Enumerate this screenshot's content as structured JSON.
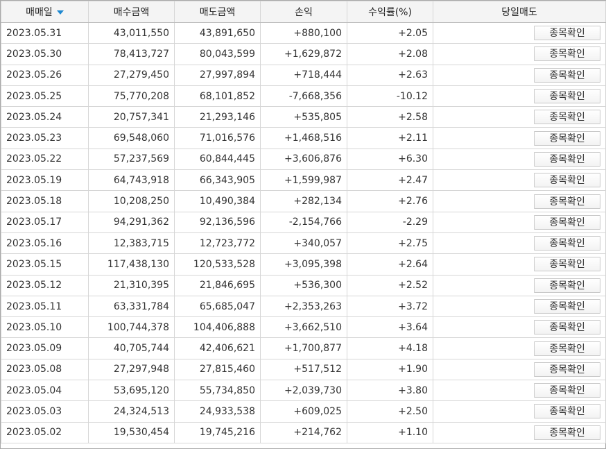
{
  "headers": {
    "date": "매매일",
    "buy": "매수금액",
    "sell": "매도금액",
    "pnl": "손익",
    "rate": "수익률(%)",
    "action": "당일매도"
  },
  "colors": {
    "positive": "#e8232c",
    "negative": "#1a69cf",
    "sort_arrow": "#1e88d0"
  },
  "rows": [
    {
      "date": "2023.05.31",
      "buy": "43,011,550",
      "sell": "43,891,650",
      "pnl": "+880,100",
      "rate": "+2.05",
      "sign": "pos",
      "action": "종목확인"
    },
    {
      "date": "2023.05.30",
      "buy": "78,413,727",
      "sell": "80,043,599",
      "pnl": "+1,629,872",
      "rate": "+2.08",
      "sign": "pos",
      "action": "종목확인"
    },
    {
      "date": "2023.05.26",
      "buy": "27,279,450",
      "sell": "27,997,894",
      "pnl": "+718,444",
      "rate": "+2.63",
      "sign": "pos",
      "action": "종목확인"
    },
    {
      "date": "2023.05.25",
      "buy": "75,770,208",
      "sell": "68,101,852",
      "pnl": "-7,668,356",
      "rate": "-10.12",
      "sign": "neg",
      "action": "종목확인"
    },
    {
      "date": "2023.05.24",
      "buy": "20,757,341",
      "sell": "21,293,146",
      "pnl": "+535,805",
      "rate": "+2.58",
      "sign": "pos",
      "action": "종목확인"
    },
    {
      "date": "2023.05.23",
      "buy": "69,548,060",
      "sell": "71,016,576",
      "pnl": "+1,468,516",
      "rate": "+2.11",
      "sign": "pos",
      "action": "종목확인"
    },
    {
      "date": "2023.05.22",
      "buy": "57,237,569",
      "sell": "60,844,445",
      "pnl": "+3,606,876",
      "rate": "+6.30",
      "sign": "pos",
      "action": "종목확인"
    },
    {
      "date": "2023.05.19",
      "buy": "64,743,918",
      "sell": "66,343,905",
      "pnl": "+1,599,987",
      "rate": "+2.47",
      "sign": "pos",
      "action": "종목확인"
    },
    {
      "date": "2023.05.18",
      "buy": "10,208,250",
      "sell": "10,490,384",
      "pnl": "+282,134",
      "rate": "+2.76",
      "sign": "pos",
      "action": "종목확인"
    },
    {
      "date": "2023.05.17",
      "buy": "94,291,362",
      "sell": "92,136,596",
      "pnl": "-2,154,766",
      "rate": "-2.29",
      "sign": "neg",
      "action": "종목확인"
    },
    {
      "date": "2023.05.16",
      "buy": "12,383,715",
      "sell": "12,723,772",
      "pnl": "+340,057",
      "rate": "+2.75",
      "sign": "pos",
      "action": "종목확인"
    },
    {
      "date": "2023.05.15",
      "buy": "117,438,130",
      "sell": "120,533,528",
      "pnl": "+3,095,398",
      "rate": "+2.64",
      "sign": "pos",
      "action": "종목확인"
    },
    {
      "date": "2023.05.12",
      "buy": "21,310,395",
      "sell": "21,846,695",
      "pnl": "+536,300",
      "rate": "+2.52",
      "sign": "pos",
      "action": "종목확인"
    },
    {
      "date": "2023.05.11",
      "buy": "63,331,784",
      "sell": "65,685,047",
      "pnl": "+2,353,263",
      "rate": "+3.72",
      "sign": "pos",
      "action": "종목확인"
    },
    {
      "date": "2023.05.10",
      "buy": "100,744,378",
      "sell": "104,406,888",
      "pnl": "+3,662,510",
      "rate": "+3.64",
      "sign": "pos",
      "action": "종목확인"
    },
    {
      "date": "2023.05.09",
      "buy": "40,705,744",
      "sell": "42,406,621",
      "pnl": "+1,700,877",
      "rate": "+4.18",
      "sign": "pos",
      "action": "종목확인"
    },
    {
      "date": "2023.05.08",
      "buy": "27,297,948",
      "sell": "27,815,460",
      "pnl": "+517,512",
      "rate": "+1.90",
      "sign": "pos",
      "action": "종목확인"
    },
    {
      "date": "2023.05.04",
      "buy": "53,695,120",
      "sell": "55,734,850",
      "pnl": "+2,039,730",
      "rate": "+3.80",
      "sign": "pos",
      "action": "종목확인"
    },
    {
      "date": "2023.05.03",
      "buy": "24,324,513",
      "sell": "24,933,538",
      "pnl": "+609,025",
      "rate": "+2.50",
      "sign": "pos",
      "action": "종목확인"
    },
    {
      "date": "2023.05.02",
      "buy": "19,530,454",
      "sell": "19,745,216",
      "pnl": "+214,762",
      "rate": "+1.10",
      "sign": "pos",
      "action": "종목확인"
    }
  ]
}
